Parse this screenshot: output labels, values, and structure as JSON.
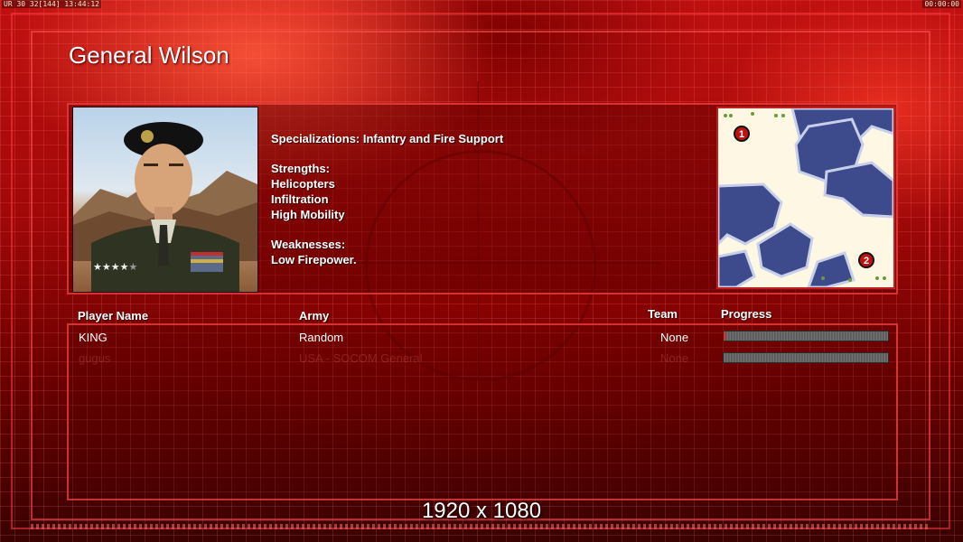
{
  "hud": {
    "left": "UR 30 32[144] 13:44:12",
    "right": "00:00:00"
  },
  "general": {
    "name": "General Wilson",
    "specializations_line": "Specializations: Infantry and Fire Support",
    "strengths_heading": "Strengths:",
    "strengths": [
      "Helicopters",
      "Infiltration",
      "High Mobility"
    ],
    "weaknesses_heading": "Weaknesses:",
    "weaknesses": [
      "Low Firepower."
    ],
    "rank_stars": "★★★★",
    "rank_stars_dim": "★"
  },
  "minimap": {
    "start_positions": [
      "1",
      "2"
    ],
    "water_color": "#3d4a8c",
    "land_color": "#fdf7e3"
  },
  "players_table": {
    "headers": {
      "player_name": "Player Name",
      "army": "Army",
      "team": "Team",
      "progress": "Progress"
    },
    "rows": [
      {
        "player_name": "KING",
        "army": "Random",
        "team": "None",
        "progress_percent": 1,
        "faded": false
      },
      {
        "player_name": "gugus",
        "army": "USA - SOCOM General",
        "team": "None",
        "progress_percent": 0,
        "faded": true
      }
    ]
  },
  "resolution_text": "1920 x 1080",
  "colors": {
    "accent_red": "#ff2020",
    "frame_red": "#c02020"
  }
}
